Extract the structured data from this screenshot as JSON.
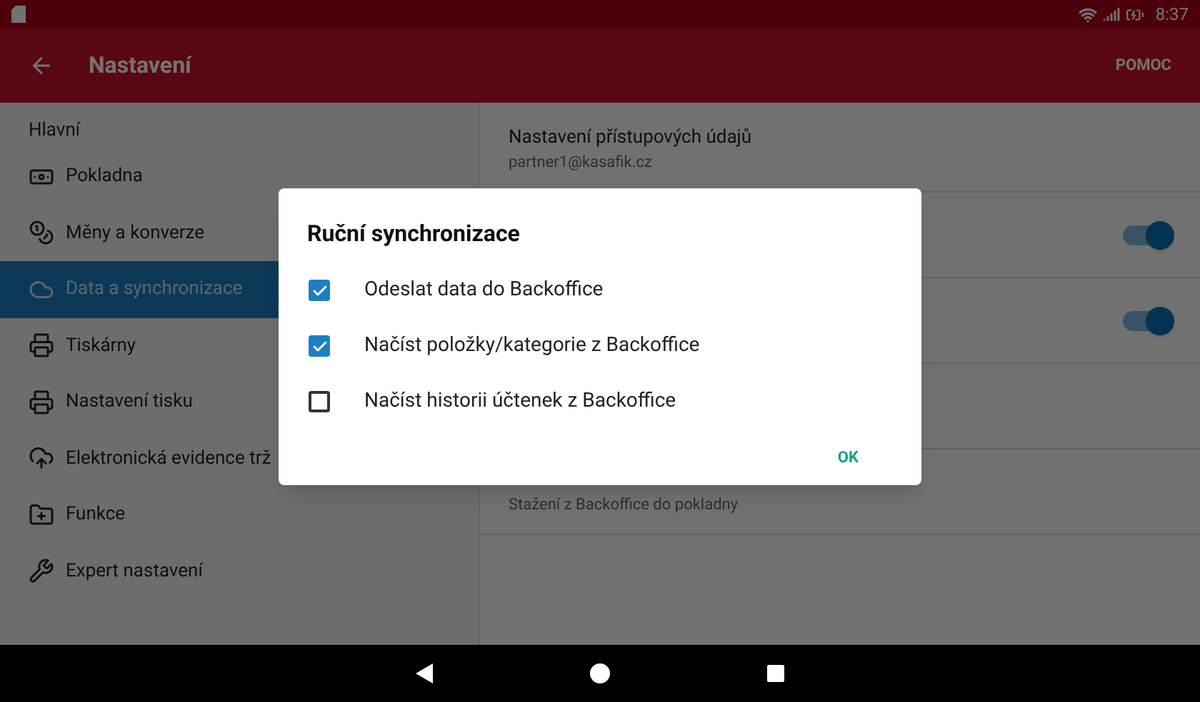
{
  "status_bar": {
    "time": "8:37"
  },
  "app_bar": {
    "title": "Nastavení",
    "action": "POMOC"
  },
  "sidebar": {
    "header": "Hlavní",
    "items": [
      {
        "label": "Pokladna",
        "selected": false
      },
      {
        "label": "Měny a konverze",
        "selected": false
      },
      {
        "label": "Data a synchronizace",
        "selected": true
      },
      {
        "label": "Tiskárny",
        "selected": false
      },
      {
        "label": "Nastavení tisku",
        "selected": false
      },
      {
        "label": "Elektronická evidence trž",
        "selected": false
      },
      {
        "label": "Funkce",
        "selected": false
      },
      {
        "label": "Expert nastavení",
        "selected": false
      }
    ]
  },
  "settings": [
    {
      "kind": "text",
      "title": "Nastavení přístupových údajů",
      "subtitle": "partner1@kasafik.cz"
    },
    {
      "kind": "toggle",
      "on": true
    },
    {
      "kind": "toggle",
      "on": true
    },
    {
      "kind": "empty"
    },
    {
      "kind": "text",
      "subtitle": "Stažení z Backoffice do pokladny"
    }
  ],
  "dialog": {
    "title": "Ruční synchronizace",
    "options": [
      {
        "label": "Odeslat data do Backoffice",
        "checked": true
      },
      {
        "label": "Načíst položky/kategorie z Backoffice",
        "checked": true
      },
      {
        "label": "Načíst historii účtenek z Backoffice",
        "checked": false
      }
    ],
    "button": "OK"
  }
}
